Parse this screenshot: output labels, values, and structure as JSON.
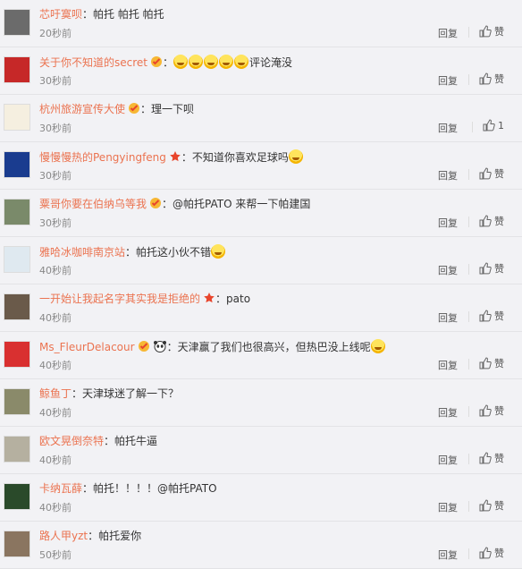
{
  "comments": [
    {
      "user": "芯吁寞呗",
      "badges": [],
      "text": "：帕托 帕托 帕托",
      "emojis": 0,
      "after_text": "",
      "time": "20秒前",
      "reply": "回复",
      "like": "赞"
    },
    {
      "user": "关于你不知道的secret",
      "badges": [
        "vip"
      ],
      "text": "：",
      "emojis": 5,
      "after_text": "评论淹没",
      "time": "30秒前",
      "reply": "回复",
      "like": "赞"
    },
    {
      "user": "杭州旅游宣传大使",
      "badges": [
        "vip"
      ],
      "text": "：理一下呗",
      "emojis": 0,
      "after_text": "",
      "time": "30秒前",
      "reply": "回复",
      "like": "1"
    },
    {
      "user": "慢慢慢热的Pengyingfeng",
      "badges": [
        "star"
      ],
      "text": "：不知道你喜欢足球吗",
      "emojis": 1,
      "after_text": "",
      "time": "30秒前",
      "reply": "回复",
      "like": "赞"
    },
    {
      "user": "粟哥你要在伯纳乌等我",
      "badges": [
        "vip"
      ],
      "text": "：@帕托PATO 来帮一下帕建国",
      "emojis": 0,
      "after_text": "",
      "time": "30秒前",
      "reply": "回复",
      "like": "赞"
    },
    {
      "user": "雅哈冰咖啡南京站",
      "badges": [],
      "text": "：帕托这小伙不错",
      "emojis": 1,
      "after_text": "",
      "time": "40秒前",
      "reply": "回复",
      "like": "赞"
    },
    {
      "user": "一开始让我起名字其实我是拒绝的",
      "badges": [
        "star"
      ],
      "text": "：pato",
      "emojis": 0,
      "after_text": "",
      "time": "40秒前",
      "reply": "回复",
      "like": "赞"
    },
    {
      "user": "Ms_FleurDelacour",
      "badges": [
        "vip",
        "panda"
      ],
      "text": "：天津赢了我们也很高兴，但热巴没上线呢",
      "emojis": 1,
      "after_text": "",
      "time": "40秒前",
      "reply": "回复",
      "like": "赞"
    },
    {
      "user": "鲸鱼丁",
      "badges": [],
      "text": "：天津球迷了解一下？",
      "emojis": 0,
      "after_text": "",
      "time": "40秒前",
      "reply": "回复",
      "like": "赞"
    },
    {
      "user": "欧文晃倒奈特",
      "badges": [],
      "text": "：帕托牛逼",
      "emojis": 0,
      "after_text": "",
      "time": "40秒前",
      "reply": "回复",
      "like": "赞"
    },
    {
      "user": "卡纳瓦薛",
      "badges": [],
      "text": "：帕托！！！！@帕托PATO",
      "emojis": 0,
      "after_text": "",
      "time": "40秒前",
      "reply": "回复",
      "like": "赞"
    },
    {
      "user": "路人甲yzt",
      "badges": [],
      "text": "：帕托爱你",
      "emojis": 0,
      "after_text": "",
      "time": "50秒前",
      "reply": "回复",
      "like": "赞"
    }
  ],
  "avatar_colors": [
    "#6b6b6b",
    "#c62828",
    "#f5efe0",
    "#1a3c8f",
    "#7a8a6a",
    "#dfe9f0",
    "#6a5a4a",
    "#d93030",
    "#8a8a6a",
    "#b5b0a0",
    "#2a4a2a",
    "#8a7560"
  ],
  "accent": "#eb7350"
}
